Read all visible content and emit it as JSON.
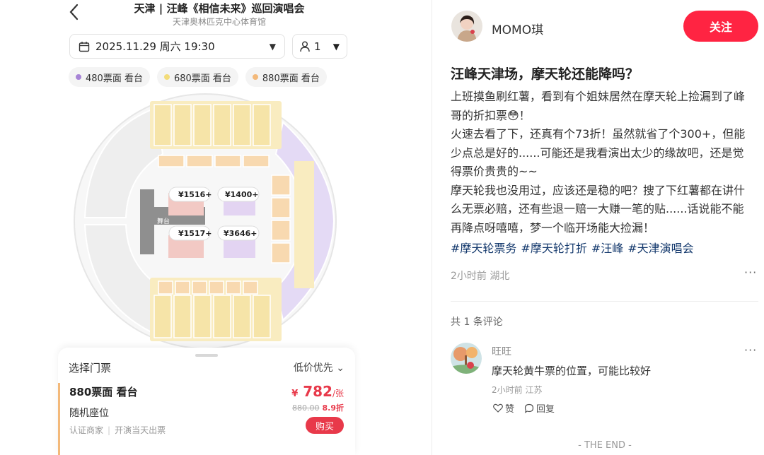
{
  "left": {
    "event_title": "天津 | 汪峰《相信未来》巡回演唱会",
    "venue": "天津奥林匹克中心体育馆",
    "date_selector": "2025.11.29 周六 19:30",
    "quantity": "1",
    "price_tags": [
      {
        "label": "480票面 看台",
        "color": "#a784d6"
      },
      {
        "label": "680票面 看台",
        "color": "#f3dc7a"
      },
      {
        "label": "880票面 看台",
        "color": "#f3b97a"
      }
    ],
    "map": {
      "stage_label": "舞台",
      "price_bubbles": [
        "¥1516+",
        "¥1400+",
        "¥1517+",
        "¥3646+"
      ]
    },
    "ticket_panel": {
      "title": "选择门票",
      "sort": "低价优先",
      "card": {
        "name": "880票面 看台",
        "seat": "随机座位",
        "merchant": "认证商家",
        "delivery": "开演当天出票",
        "currency": "¥",
        "price": "782",
        "unit": "/张",
        "original_price": "880.00",
        "discount": "8.9折",
        "buy_label": "购买"
      }
    }
  },
  "right": {
    "username": "MOMO琪",
    "follow_label": "关注",
    "post_title": "汪峰天津场，摩天轮还能降吗？",
    "post_paragraphs": [
      "上班摸鱼刷红薯，看到有个姐妹居然在摩天轮上捡漏到了峰哥的折扣票😳！",
      "火速去看了下，还真有个73折！虽然就省了个300+，但能少点总是好的......可能还是我看演出太少的缘故吧，还是觉得票价贵贵的~~",
      "摩天轮我也没用过，应该还是稳的吧？搜了下红薯都在讲什么无票必赔，还有些退一赔一大赚一笔的贴......话说能不能再降点呀嘻嘻，梦一个临开场能大捡漏！"
    ],
    "hashtags": [
      "#摩天轮票务",
      "#摩天轮打折",
      "#汪峰",
      "#天津演唱会"
    ],
    "post_meta": "2小时前 湖北",
    "comment_count": "共 1 条评论",
    "comment": {
      "name": "旺旺",
      "text": "摩天轮黄牛票的位置，可能比较好",
      "meta": "2小时前 江苏",
      "like_label": "赞",
      "reply_label": "回复"
    },
    "end_text": "- THE END -"
  },
  "colors": {
    "accent_red": "#ff2442",
    "price_red": "#e8394a",
    "hashtag_blue": "#13386c"
  }
}
